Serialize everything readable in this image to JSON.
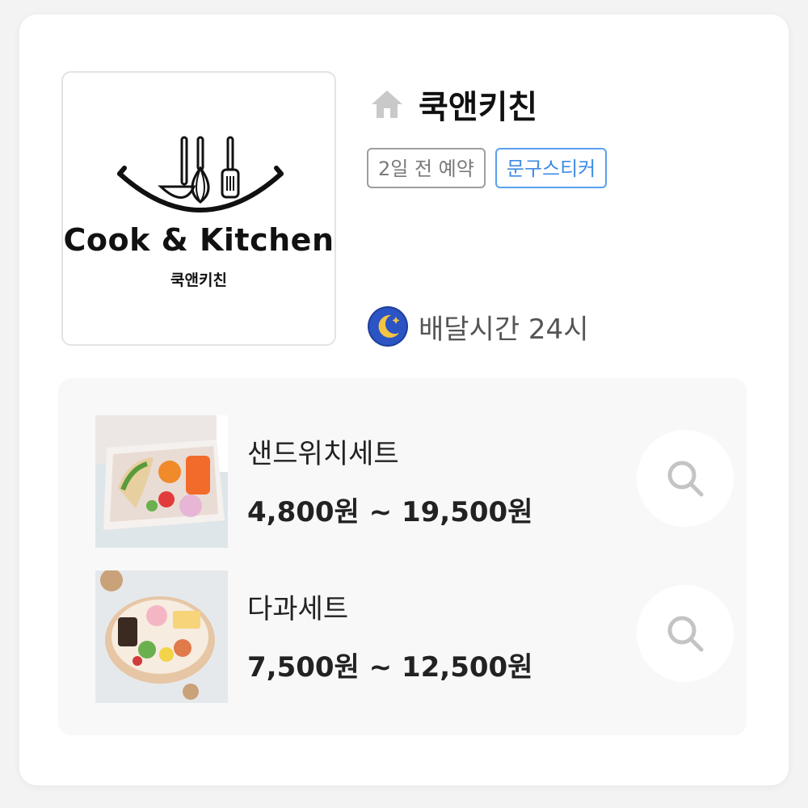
{
  "store": {
    "logo": {
      "title_en": "Cook & Kitchen",
      "title_ko": "쿡앤키친"
    },
    "name": "쿡앤키친",
    "name_icon": "home-icon",
    "tags": [
      "2일 전 예약",
      "문구스티커"
    ],
    "delivery": {
      "icon": "moon-night-icon",
      "text": "배달시간 24시"
    }
  },
  "menu": [
    {
      "name": "샌드위치세트",
      "price": "4,800원 ~ 19,500원",
      "thumb_alt": "sandwich-set-photo",
      "action_icon": "search-icon"
    },
    {
      "name": "다과세트",
      "price": "7,500원 ~ 12,500원",
      "thumb_alt": "dessert-set-photo",
      "action_icon": "search-icon"
    }
  ],
  "colors": {
    "tag_gray": "#9e9e9e",
    "tag_blue": "#3e8be6",
    "panel_bg": "#f8f8f8"
  }
}
